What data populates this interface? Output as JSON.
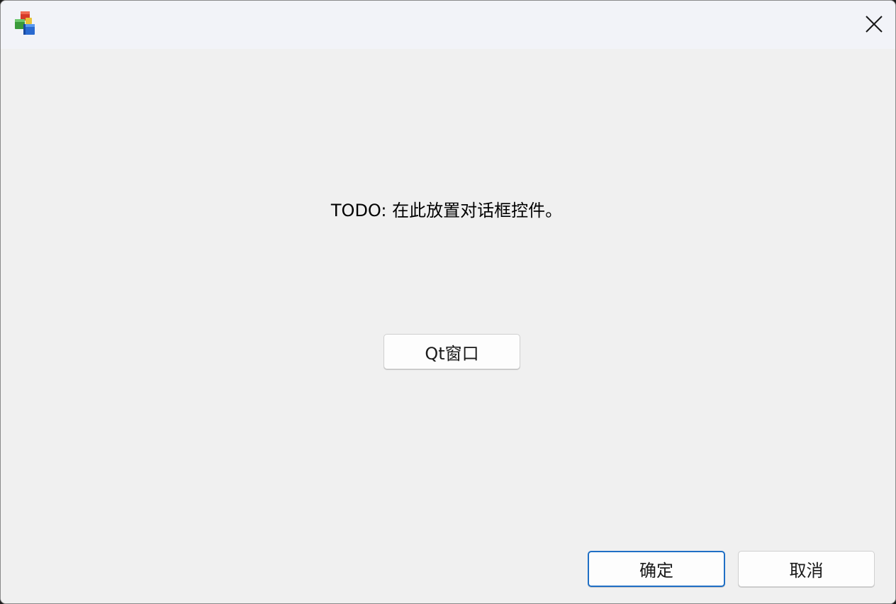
{
  "window": {
    "title": "",
    "close_icon": "close-icon",
    "app_icon": "mfc-app-icon"
  },
  "dialog": {
    "static_text": "TODO: 在此放置对话框控件。",
    "qt_button_label": "Qt窗口",
    "ok_button_label": "确定",
    "cancel_button_label": "取消"
  },
  "colors": {
    "accent": "#1f6fc5",
    "background": "#f0f0f0",
    "titlebar": "#f2f3f8"
  }
}
